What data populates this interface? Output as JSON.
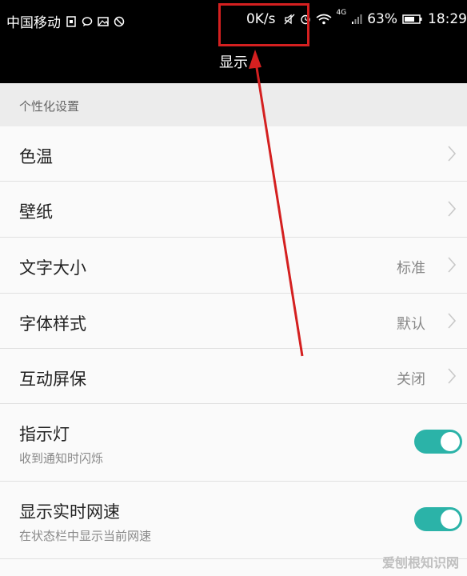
{
  "status_bar": {
    "carrier": "中国移动",
    "net_speed": "0K/s",
    "network_type": "4G",
    "battery": "63%",
    "time": "18:29"
  },
  "title_bar": {
    "title": "显示"
  },
  "section": {
    "header": "个性化设置"
  },
  "rows": [
    {
      "label": "色温",
      "value": ""
    },
    {
      "label": "壁纸",
      "value": ""
    },
    {
      "label": "文字大小",
      "value": "标准"
    },
    {
      "label": "字体样式",
      "value": "默认"
    },
    {
      "label": "互动屏保",
      "value": "关闭"
    }
  ],
  "toggles": [
    {
      "label": "指示灯",
      "subtitle": "收到通知时闪烁",
      "on": true
    },
    {
      "label": "显示实时网速",
      "subtitle": "在状态栏中显示当前网速",
      "on": true
    }
  ],
  "watermark": "爱刨根知识网",
  "colors": {
    "accent": "#2bb3a8",
    "annotation": "#d42020"
  }
}
